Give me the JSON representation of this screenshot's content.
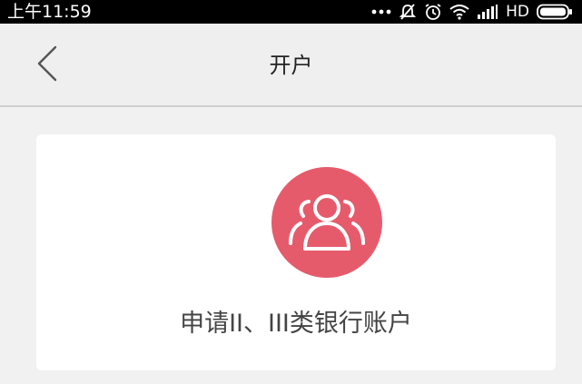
{
  "status_bar": {
    "time": "上午11:59",
    "network": "HD",
    "icons": [
      "more-dots-icon",
      "mute-icon",
      "alarm-icon",
      "wifi-icon",
      "signal-icon",
      "battery-icon"
    ]
  },
  "nav": {
    "title": "开户",
    "back_icon": "chevron-left-icon"
  },
  "card": {
    "icon": "users-icon",
    "icon_color": "#e65b6b",
    "label": "申请II、III类银行账户"
  }
}
